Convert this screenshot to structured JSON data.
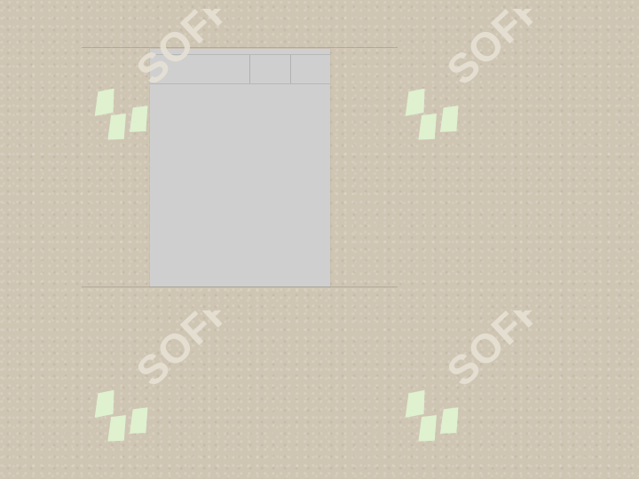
{
  "panel": {
    "header_cells": [
      "",
      "",
      ""
    ]
  },
  "watermark": {
    "text": "SOFF"
  }
}
